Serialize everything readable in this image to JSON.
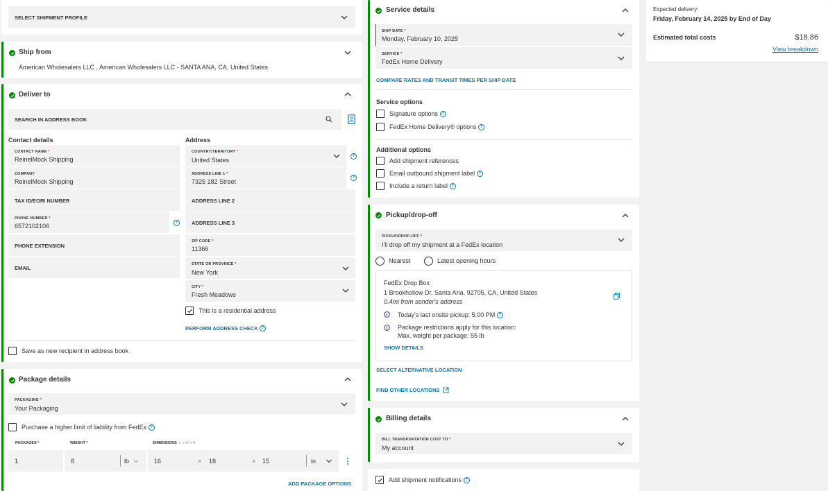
{
  "shipment_profile": {
    "label": "SELECT SHIPMENT PROFILE"
  },
  "ship_from": {
    "title": "Ship from",
    "address": "American Wholesalers LLC , American Wholesalers LLC - SANTA ANA, CA, United States"
  },
  "deliver_to": {
    "title": "Deliver to",
    "search_label": "SEARCH IN ADDRESS BOOK",
    "contact_heading": "Contact details",
    "address_heading": "Address",
    "contact_name_label": "CONTACT NAME",
    "contact_name": "ReinelMock Shipping",
    "company_label": "COMPANY",
    "company": "ReinelMock Shipping",
    "tax_id_label": "TAX ID/EORI NUMBER",
    "phone_label": "PHONE NUMBER",
    "phone": "6572102106",
    "phone_ext_label": "PHONE EXTENSION",
    "email_label": "EMAIL",
    "country_label": "COUNTRY/TERRITORY",
    "country": "United States",
    "address1_label": "ADDRESS LINE 1",
    "address1": "7325 182 Street",
    "address2_label": "ADDRESS LINE 2",
    "address3_label": "ADDRESS LINE 3",
    "zip_label": "ZIP CODE",
    "zip": "11366",
    "state_label": "STATE OR PROVINCE",
    "state": "New York",
    "city_label": "CITY",
    "city": "Fresh Meadows",
    "residential_label": "This is a residential address",
    "address_check_link": "PERFORM ADDRESS CHECK",
    "save_recipient_label": "Save as new recipient in address book"
  },
  "package_details": {
    "title": "Package details",
    "packaging_label": "PACKAGING",
    "packaging": "Your Packaging",
    "liability_label": "Purchase a higher limit of liability from FedEx",
    "packages_label": "PACKAGES",
    "weight_label": "WEIGHT",
    "dimensions_label": "DIMENSIONS",
    "dimensions_hint": "L x W x H",
    "packages": "1",
    "weight": "8",
    "weight_unit": "lb",
    "length": "16",
    "width": "18",
    "height": "15",
    "dim_unit": "in",
    "times": "×",
    "add_options_link": "ADD PACKAGE OPTIONS"
  },
  "service_details": {
    "title": "Service details",
    "ship_date_label": "SHIP DATE",
    "ship_date": "Monday, February 10, 2025",
    "service_label": "SERVICE",
    "service": "FedEx Home Delivery",
    "compare_link": "COMPARE RATES AND TRANSIT TIMES PER SHIP DATE",
    "service_options_heading": "Service options",
    "signature_options": "Signature options",
    "home_delivery_options": "FedEx Home Delivery® options",
    "additional_options_heading": "Additional options",
    "add_references": "Add shipment references",
    "email_outbound_label": "Email outbound shipment label",
    "include_return_label": "Include a return label"
  },
  "pickup": {
    "title": "Pickup/drop-off",
    "field_label": "PICKUP/DROP-OFF",
    "value": "I'll drop off my shipment at a FedEx location",
    "radio_nearest": "Nearest",
    "radio_latest": "Latest opening hours",
    "location_name": "FedEx Drop Box",
    "location_address": "1 Brookhollow Dr, Santa Ana, 92705, CA, United States",
    "location_distance": "0.4mi from sender's address",
    "last_pickup": "Today's last onsite pickup: 5:00 PM",
    "restrictions_line1": "Package restrictions apply for this location:",
    "restrictions_line2": "Max. weight per package: 55 lb",
    "show_details_link": "SHOW DETAILS",
    "alt_location_link": "SELECT ALTERNATIVE LOCATION",
    "other_locations_link": "FIND OTHER LOCATIONS"
  },
  "billing": {
    "title": "Billing details",
    "field_label": "BILL TRANSPORTATION COST TO",
    "value": "My account"
  },
  "notifications": {
    "label": "Add shipment notifications"
  },
  "summary": {
    "expected_label": "Expected delivery:",
    "expected_value": "Friday, February 14, 2025 by End of Day",
    "total_label": "Estimated total costs",
    "total_value": "$18.86",
    "breakdown_link": "View breakdown"
  },
  "icons": {
    "help_glyph": "?"
  }
}
